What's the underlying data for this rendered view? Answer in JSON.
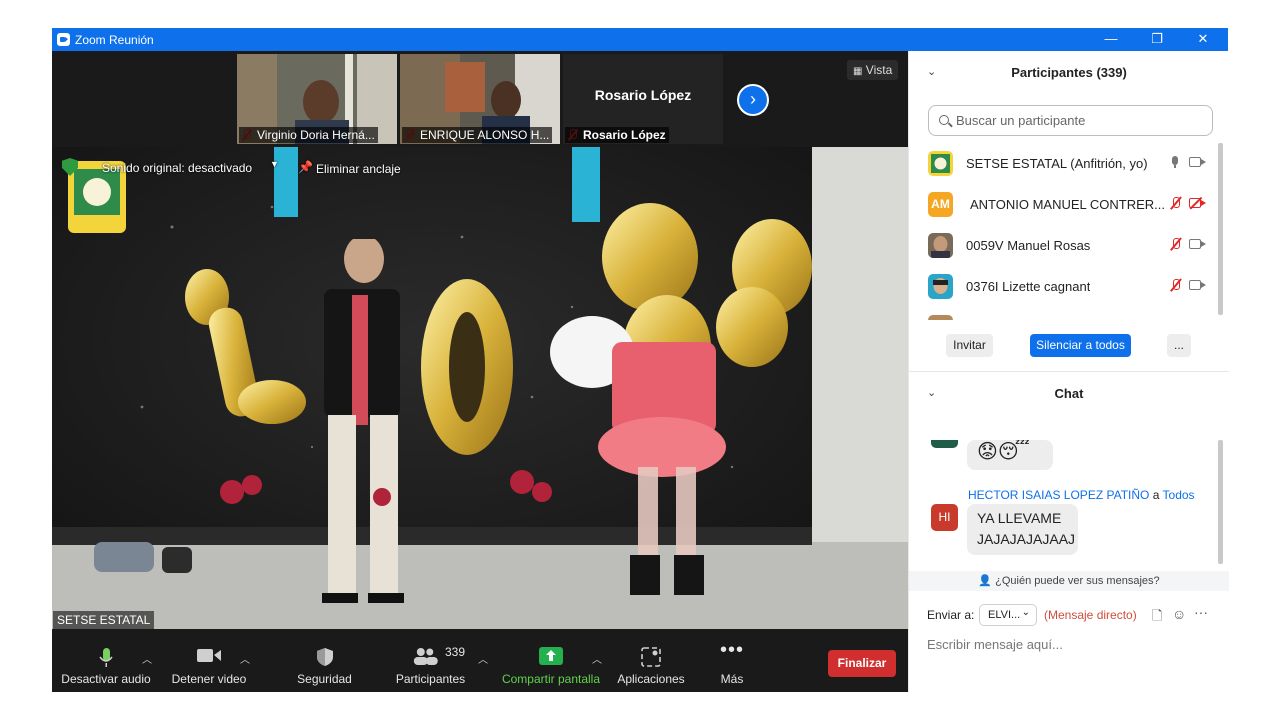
{
  "window": {
    "title": "Zoom Reunión",
    "minimize": "—",
    "restore": "❐",
    "close": "✕"
  },
  "thumbnails": [
    {
      "name": "Virginio Doria Herná..."
    },
    {
      "name": "ENRIQUE ALONSO H..."
    },
    {
      "name": "Rosario López",
      "display_name": "Rosario López"
    }
  ],
  "view_button": "Vista",
  "stage": {
    "sound_status": "Sonido original: desactivado",
    "unpin": "Eliminar anclaje",
    "speaker": "SETSE ESTATAL"
  },
  "toolbar": {
    "mute": "Desactivar audio",
    "video": "Detener video",
    "security": "Seguridad",
    "participants": "Participantes",
    "participants_count": "339",
    "share": "Compartir pantalla",
    "apps": "Aplicaciones",
    "more": "Más",
    "end": "Finalizar"
  },
  "participants_panel": {
    "title": "Participantes (339)",
    "search_placeholder": "Buscar un participante",
    "items": [
      {
        "name": "SETSE ESTATAL (Anfitrión, yo)",
        "avatar": "logo",
        "mic": "on",
        "cam": "on"
      },
      {
        "name": "ANTONIO MANUEL CONTRER...",
        "avatar": "AM",
        "avatar_color": "#f5a623",
        "mic": "off",
        "cam": "off"
      },
      {
        "name": "0059V Manuel Rosas",
        "avatar": "photo",
        "mic": "off",
        "cam": "on"
      },
      {
        "name": "0376I Lizette cagnant",
        "avatar": "photo",
        "mic": "off",
        "cam": "on"
      }
    ],
    "invite": "Invitar",
    "mute_all": "Silenciar a todos",
    "more": "..."
  },
  "chat_panel": {
    "title": "Chat",
    "sender": "HECTOR ISAIAS LOPEZ PATIÑO",
    "connector": "a",
    "recipient": "Todos",
    "sender_initials": "HI",
    "message_line1": "YA LLEVAME",
    "message_line2": "JAJAJAJAJAAJ",
    "emoji_line": "😟😴",
    "privacy": "¿Quién puede ver sus mensajes?",
    "send_to_label": "Enviar a:",
    "send_to_value": "ELVI...",
    "direct_message": "(Mensaje directo)",
    "input_placeholder": "Escribir mensaje aquí..."
  }
}
